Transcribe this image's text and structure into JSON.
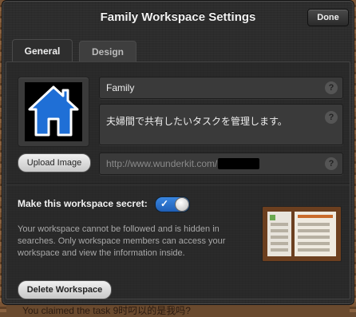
{
  "window": {
    "title": "Family Workspace Settings",
    "done_label": "Done"
  },
  "tabs": [
    {
      "label": "General",
      "active": true
    },
    {
      "label": "Design",
      "active": false
    }
  ],
  "general": {
    "icon": "house-icon",
    "upload_label": "Upload Image",
    "name_value": "Family",
    "description_value": "夫婦間で共有したいタスクを管理します。",
    "url_value": "http://www.wunderkit.com/",
    "help_glyph": "?",
    "secret_label": "Make this workspace secret:",
    "secret_enabled": true,
    "toggle_check": "✓",
    "secret_description": "Your workspace cannot be followed and is hidden in searches. Only workspace members can access your workspace and view the information inside.",
    "delete_label": "Delete Workspace"
  },
  "background": {
    "bottom_text": "You claimed the task 9时叼以的是我吗?"
  },
  "colors": {
    "accent_blue": "#1f6fd6",
    "modal_bg": "#2c2c2c",
    "wood": "#6a4a2e"
  }
}
